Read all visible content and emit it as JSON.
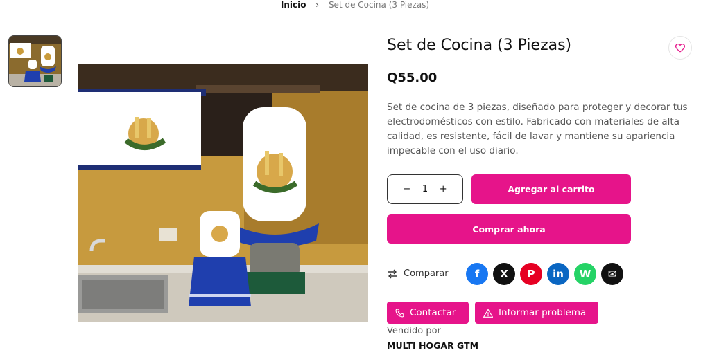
{
  "breadcrumb": {
    "home": "Inicio",
    "current": "Set de Cocina (3 Piezas)"
  },
  "product": {
    "title": "Set de Cocina (3 Piezas)",
    "price": "Q55.00",
    "description": "Set de cocina de 3 piezas, diseñado para proteger y decorar tus electrodomésticos con estilo. Fabricado con materiales de alta calidad, es resistente, fácil de lavar y mantiene su apariencia impecable con el uso diario."
  },
  "quantity": {
    "minus": "−",
    "value": "1",
    "plus": "+"
  },
  "actions": {
    "add_to_cart": "Agregar al carrito",
    "buy_now": "Comprar ahora",
    "compare": "Comparar",
    "contact": "Contactar",
    "report": "Informar problema"
  },
  "share": [
    {
      "name": "facebook-icon",
      "glyph": "f",
      "color": "#1877f2"
    },
    {
      "name": "x-icon",
      "glyph": "X",
      "color": "#111111"
    },
    {
      "name": "pinterest-icon",
      "glyph": "P",
      "color": "#e60023"
    },
    {
      "name": "linkedin-icon",
      "glyph": "in",
      "color": "#0a66c2"
    },
    {
      "name": "whatsapp-icon",
      "glyph": "W",
      "color": "#25d366"
    },
    {
      "name": "email-icon",
      "glyph": "✉",
      "color": "#111111"
    }
  ],
  "seller": {
    "label": "Vendido por",
    "name": "MULTI HOGAR GTM"
  },
  "colors": {
    "accent": "#e6148a"
  }
}
